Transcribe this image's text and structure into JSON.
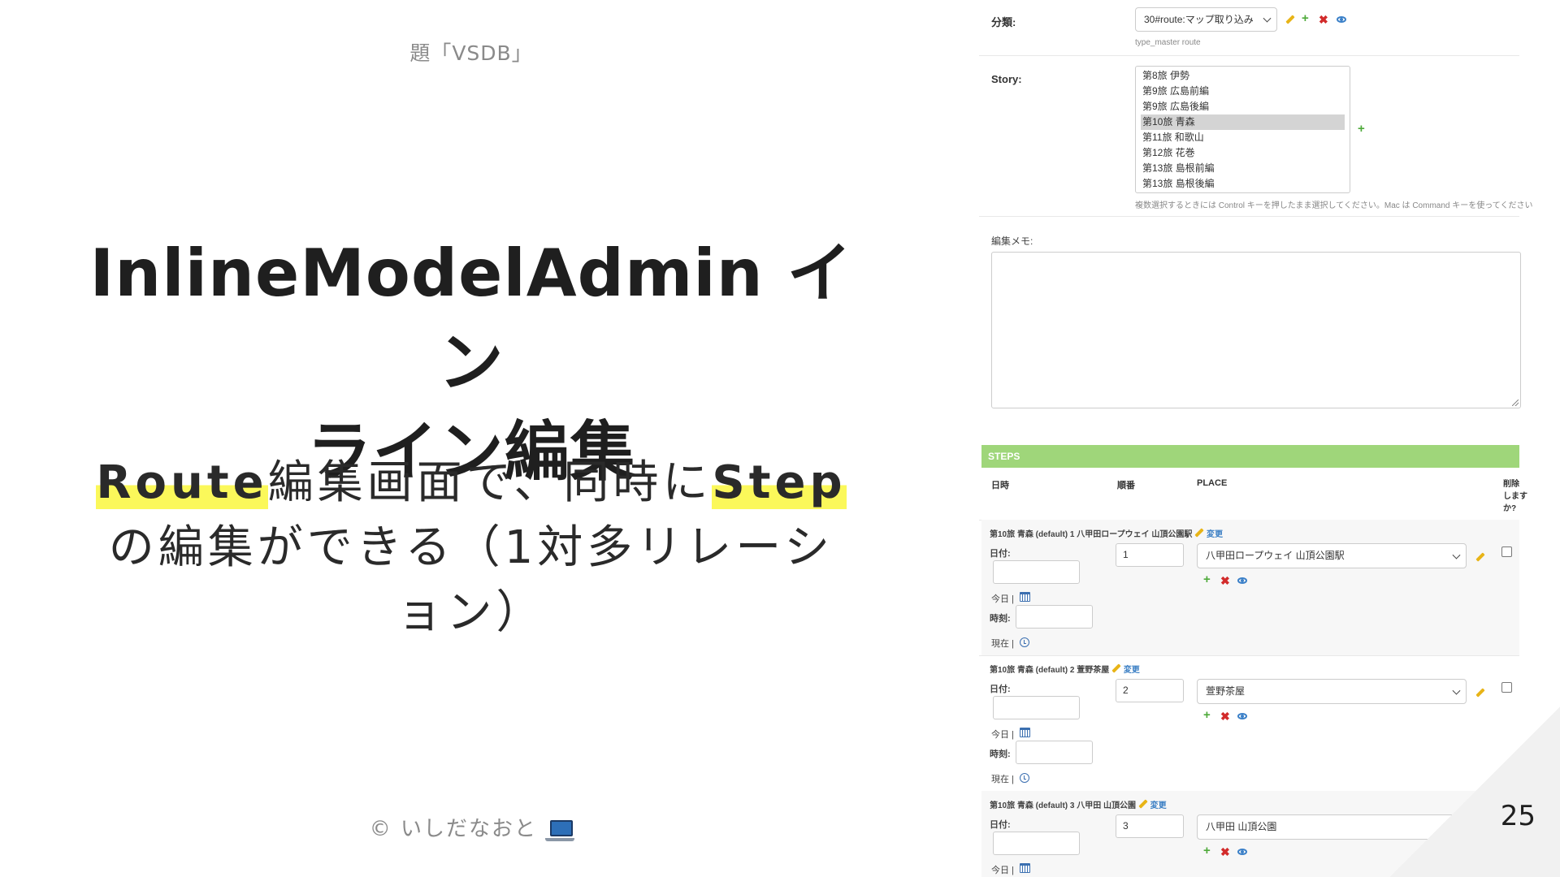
{
  "slide": {
    "header": "題「VSDB」",
    "title_line1": "InlineModelAdmin イン",
    "title_line2": "ライン編集",
    "subtitle_hl1": "Route",
    "subtitle_mid": "編集画面で、同時に",
    "subtitle_hl2": "Step",
    "subtitle_line2": "の編集ができる（1対多リレーシ",
    "subtitle_line3": "ョン）",
    "footer": "© いしだなおと",
    "footer_icon": "laptop-icon",
    "page_number": "25"
  },
  "admin": {
    "category_label": "分類:",
    "category_value": "30#route:マップ取り込み",
    "category_help": "type_master route",
    "story_label": "Story:",
    "story_options": [
      "第8旅 伊勢",
      "第9旅 広島前編",
      "第9旅 広島後編",
      "第10旅 青森",
      "第11旅 和歌山",
      "第12旅 花巻",
      "第13旅 島根前編",
      "第13旅 島根後編"
    ],
    "story_selected": "第10旅 青森",
    "story_help": "複数選択するときには Control キーを押したまま選択してください。Mac は Command キーを使ってください",
    "memo_label": "編集メモ:",
    "steps_title": "STEPS",
    "col_datetime": "日時",
    "col_order": "順番",
    "col_place": "PLACE",
    "col_delete_1": "削除",
    "col_delete_2": "します",
    "col_delete_3": "か?",
    "date_label": "日付:",
    "time_label": "時刻:",
    "today_link": "今日 |",
    "now_link": "現在 |",
    "change_link": "変更",
    "steps": [
      {
        "title": "第10旅 青森 (default) 1 八甲田ロープウェイ 山頂公園駅",
        "order": "1",
        "place": "八甲田ロープウェイ 山頂公園駅"
      },
      {
        "title": "第10旅 青森 (default) 2 萱野茶屋",
        "order": "2",
        "place": "萱野茶屋"
      },
      {
        "title": "第10旅 青森 (default) 3 八甲田 山頂公園",
        "order": "3",
        "place": "八甲田 山頂公園"
      }
    ]
  },
  "colors": {
    "highlight": "#fbf85a",
    "steps_bar": "#9fd67a",
    "add": "#4eaa3a",
    "delete": "#d22b2b",
    "view": "#3b80c8"
  }
}
